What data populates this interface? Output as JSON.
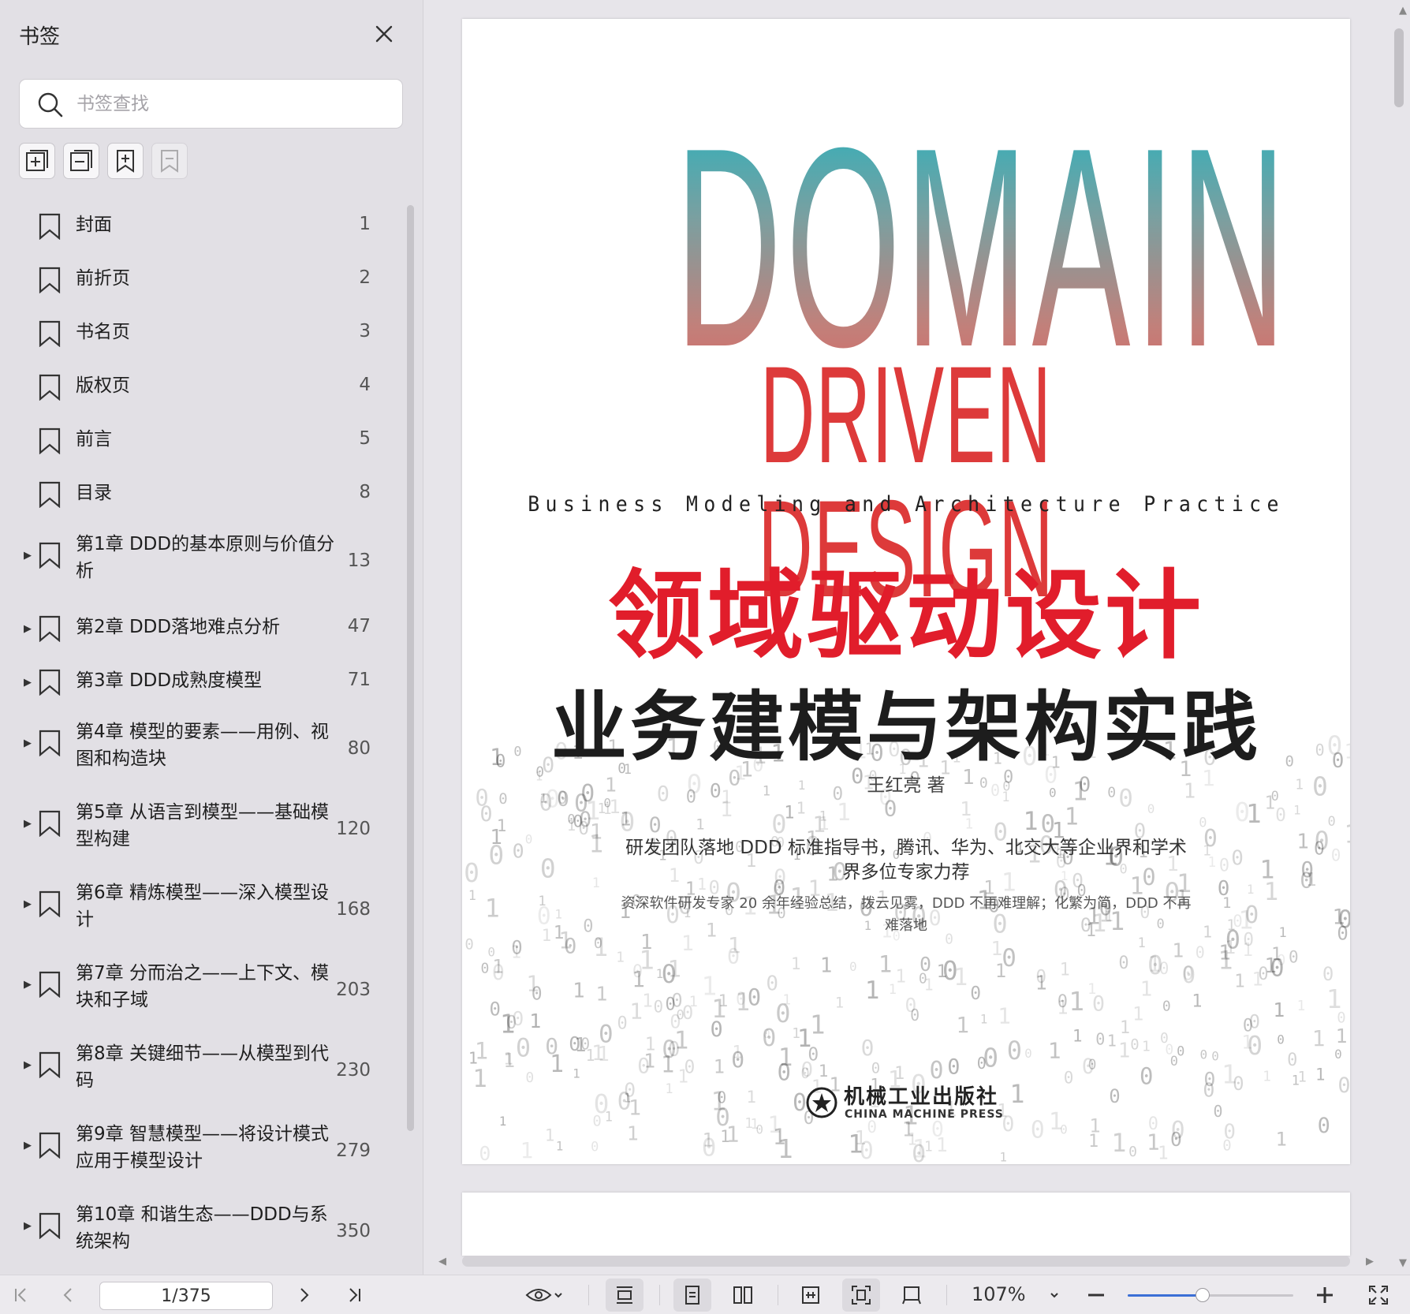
{
  "sidebar": {
    "title": "书签",
    "search_placeholder": "书签查找",
    "tools": [
      "expand-all-icon",
      "collapse-all-icon",
      "add-bookmark-icon",
      "remove-bookmark-icon"
    ],
    "bookmarks": [
      {
        "label": "封面",
        "page": "1",
        "expandable": false
      },
      {
        "label": "前折页",
        "page": "2",
        "expandable": false
      },
      {
        "label": "书名页",
        "page": "3",
        "expandable": false
      },
      {
        "label": "版权页",
        "page": "4",
        "expandable": false
      },
      {
        "label": "前言",
        "page": "5",
        "expandable": false
      },
      {
        "label": "目录",
        "page": "8",
        "expandable": false
      },
      {
        "label": "第1章 DDD的基本原则与价值分析",
        "page": "13",
        "expandable": true
      },
      {
        "label": "第2章 DDD落地难点分析",
        "page": "47",
        "expandable": true
      },
      {
        "label": "第3章 DDD成熟度模型",
        "page": "71",
        "expandable": true
      },
      {
        "label": "第4章 模型的要素——用例、视图和构造块",
        "page": "80",
        "expandable": true
      },
      {
        "label": "第5章 从语言到模型——基础模型构建",
        "page": "120",
        "expandable": true
      },
      {
        "label": "第6章 精炼模型——深入模型设计",
        "page": "168",
        "expandable": true
      },
      {
        "label": "第7章 分而治之——上下文、模块和子域",
        "page": "203",
        "expandable": true
      },
      {
        "label": "第8章 关键细节——从模型到代码",
        "page": "230",
        "expandable": true
      },
      {
        "label": "第9章 智慧模型——将设计模式应用于模型设计",
        "page": "279",
        "expandable": true
      },
      {
        "label": "第10章 和谐生态——DDD与系统架构",
        "page": "350",
        "expandable": true
      }
    ]
  },
  "cover": {
    "line1": "DOMAIN",
    "line2": "DRIVEN DESIGN",
    "subtitle_en": "Business Modeling and Architecture Practice",
    "title_cn": "领域驱动设计",
    "subtitle_cn": "业务建模与架构实践",
    "author": "王红亮 著",
    "promo1": "研发团队落地 DDD 标准指导书，腾讯、华为、北交大等企业界和学术界多位专家力荐",
    "promo2": "资深软件研发专家 20 余年经验总结，拨云见雾，DDD 不再难理解；化繁为简，DDD 不再难落地",
    "publisher_cn": "机械工业出版社",
    "publisher_en": "CHINA MACHINE PRESS"
  },
  "toolbar": {
    "page_indicator": "1/375",
    "zoom": "107%",
    "zoom_fraction": 0.45
  },
  "colors": {
    "title_red": "#e11d2b",
    "accent_blue": "#3b6fd6",
    "teal": "#1bb5c2"
  }
}
